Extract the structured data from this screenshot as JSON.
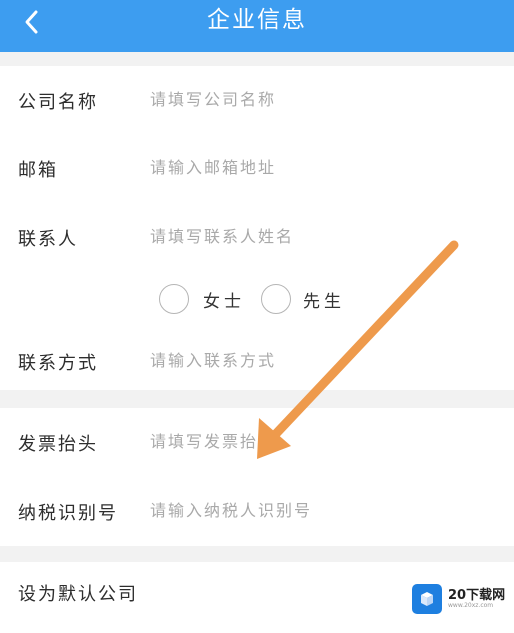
{
  "header": {
    "title": "企业信息"
  },
  "form": {
    "company_name": {
      "label": "公司名称",
      "placeholder": "请填写公司名称"
    },
    "email": {
      "label": "邮箱",
      "placeholder": "请输入邮箱地址"
    },
    "contact": {
      "label": "联系人",
      "placeholder": "请填写联系人姓名"
    },
    "gender": {
      "female": "女士",
      "male": "先生"
    },
    "phone": {
      "label": "联系方式",
      "placeholder": "请输入联系方式"
    },
    "invoice_title": {
      "label": "发票抬头",
      "placeholder": "请填写发票抬头"
    },
    "tax_id": {
      "label": "纳税识别号",
      "placeholder": "请输入纳税人识别号"
    },
    "default_company": {
      "label": "设为默认公司"
    }
  },
  "watermark": {
    "text": "20下载网",
    "url": "www.20xz.com"
  },
  "colors": {
    "header": "#3d9df0",
    "arrow": "#ee9a4c"
  }
}
